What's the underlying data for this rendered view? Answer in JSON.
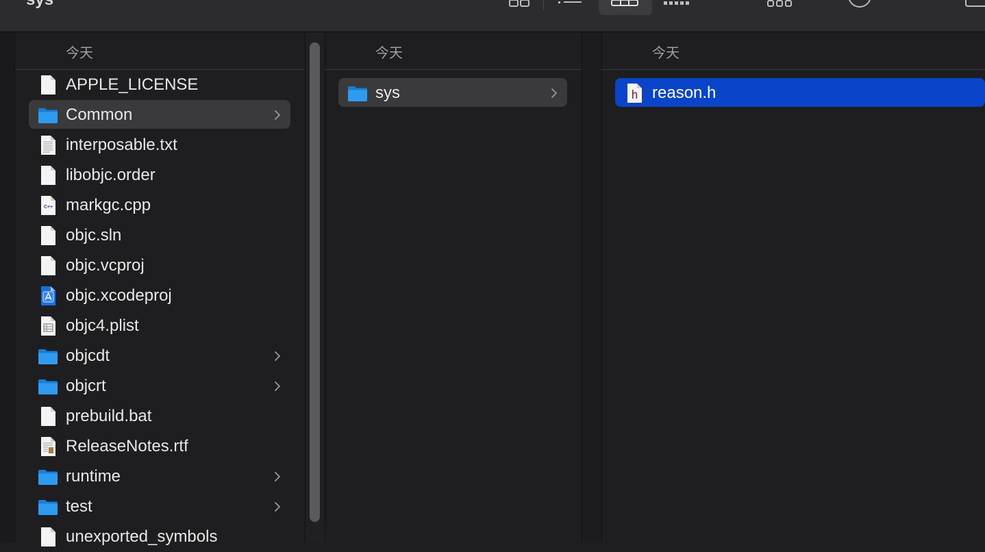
{
  "window": {
    "title": "sys"
  },
  "toolbar": {
    "icons": [
      "icon-view-icon",
      "list-view-icon",
      "column-view-icon",
      "gallery-view-icon",
      "group-icon",
      "share-icon",
      "tag-icon"
    ]
  },
  "columns": [
    {
      "header": "今天",
      "items": [
        {
          "label": "APPLE_LICENSE",
          "kind": "file-blank",
          "folder": false
        },
        {
          "label": "Common",
          "kind": "folder",
          "folder": true,
          "selected": true
        },
        {
          "label": "interposable.txt",
          "kind": "file-text",
          "folder": false
        },
        {
          "label": "libobjc.order",
          "kind": "file-blank",
          "folder": false
        },
        {
          "label": "markgc.cpp",
          "kind": "file-cpp",
          "folder": false
        },
        {
          "label": "objc.sln",
          "kind": "file-blank",
          "folder": false
        },
        {
          "label": "objc.vcproj",
          "kind": "file-blank",
          "folder": false
        },
        {
          "label": "objc.xcodeproj",
          "kind": "xcodeproj",
          "folder": false
        },
        {
          "label": "objc4.plist",
          "kind": "file-plist",
          "folder": false
        },
        {
          "label": "objcdt",
          "kind": "folder",
          "folder": true
        },
        {
          "label": "objcrt",
          "kind": "folder",
          "folder": true
        },
        {
          "label": "prebuild.bat",
          "kind": "file-blank",
          "folder": false
        },
        {
          "label": "ReleaseNotes.rtf",
          "kind": "file-rtf",
          "folder": false
        },
        {
          "label": "runtime",
          "kind": "folder",
          "folder": true
        },
        {
          "label": "test",
          "kind": "folder",
          "folder": true
        },
        {
          "label": "unexported_symbols",
          "kind": "file-blank",
          "folder": false
        }
      ]
    },
    {
      "header": "今天",
      "items": [
        {
          "label": "sys",
          "kind": "folder",
          "folder": true,
          "selected": true
        }
      ]
    },
    {
      "header": "今天",
      "items": [
        {
          "label": "reason.h",
          "kind": "file-h",
          "folder": false,
          "active": true
        }
      ]
    }
  ],
  "colors": {
    "accent": "#0a44c8",
    "folder": "#2e9bf0",
    "background": "#1e1e20"
  }
}
